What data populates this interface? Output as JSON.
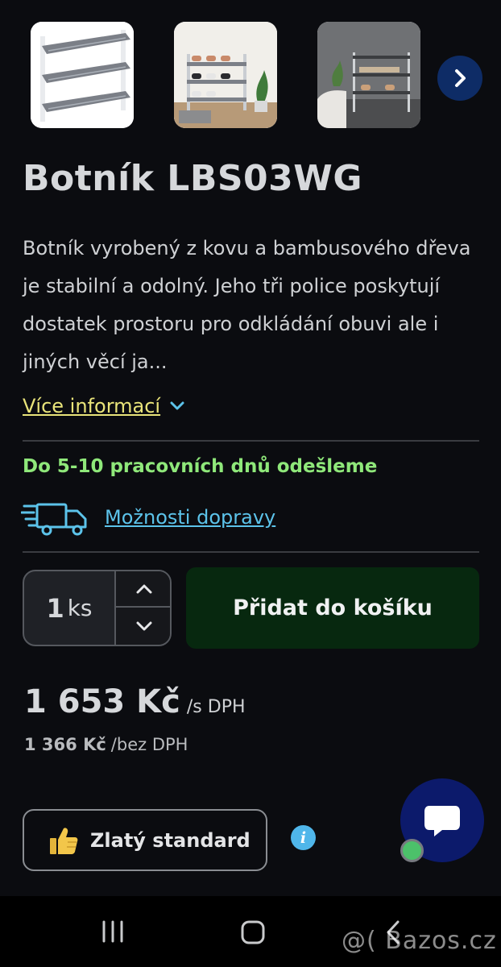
{
  "gallery": {
    "images": [
      {
        "alt": "shoe rack white frame grey shelves"
      },
      {
        "alt": "shoe rack with shoes in room"
      },
      {
        "alt": "shoe rack in bathroom"
      }
    ],
    "next_icon": "chevron-right-icon"
  },
  "product": {
    "title": "Botník LBS03WG",
    "description_lines": [
      "Botník vyrobený z kovu a bambusového dřeva",
      "je stabilní a odolný. Jeho tři police poskytují",
      "dostatek prostoru pro odkládání obuvi ale i",
      "jiných věcí ja..."
    ],
    "more_info_label": "Více informací"
  },
  "shipping": {
    "dispatch_text": "Do 5-10 pracovních dnů odešleme",
    "delivery_link": "Možnosti dopravy",
    "icon": "delivery-truck-icon"
  },
  "cart": {
    "quantity": "1",
    "unit": "ks",
    "add_button": "Přidat do košíku"
  },
  "price": {
    "with_vat": "1 653 Kč",
    "with_vat_suffix": "/s DPH",
    "without_vat": "1 366 Kč",
    "without_vat_suffix": "/bez DPH"
  },
  "badge": {
    "label": "Zlatý standard",
    "icon": "thumbs-up-icon",
    "info_symbol": "i"
  },
  "colors": {
    "background": "#0b0c10",
    "accent_green": "#8fe87a",
    "link_blue": "#5cc3ea",
    "more_yellow": "#e9e47a",
    "add_button_bg": "#07280f",
    "chat_bg": "#0c1a6b"
  },
  "watermark": "@( Bazos.cz"
}
